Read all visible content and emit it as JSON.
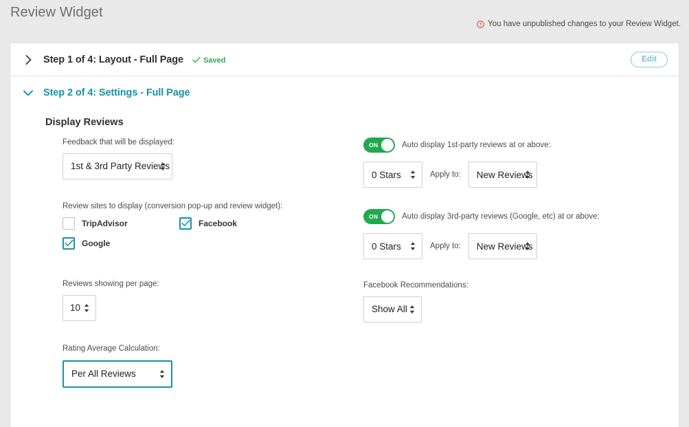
{
  "header": {
    "title": "Review Widget",
    "unpublished_notice": "You have unpublished changes to your Review Widget.",
    "warning_icon": "warning-circle-icon"
  },
  "steps": [
    {
      "chevron": "chevron-right-icon",
      "label": "Step 1 of 4: Layout - Full Page",
      "status": "Saved",
      "status_icon": "check-icon",
      "action_label": "Edit"
    },
    {
      "chevron": "chevron-down-icon",
      "label": "Step 2 of 4: Settings - Full Page"
    }
  ],
  "settings": {
    "section_title": "Display Reviews",
    "left": {
      "feedback": {
        "label": "Feedback that will be displayed:",
        "value": "1st & 3rd Party Reviews"
      },
      "review_sites": {
        "label": "Review sites to display (conversion pop-up and review widget):",
        "items": [
          {
            "name": "TripAdvisor",
            "checked": false
          },
          {
            "name": "Facebook",
            "checked": true
          },
          {
            "name": "Google",
            "checked": true
          }
        ]
      },
      "per_page": {
        "label": "Reviews showing per page:",
        "value": "10"
      },
      "rating_average": {
        "label": "Rating Average Calculation:",
        "value": "Per All Reviews",
        "focused": true
      }
    },
    "right": {
      "first_party": {
        "toggle_state": "ON",
        "label": "Auto display 1st-party reviews at or above:",
        "stars_value": "0 Stars",
        "apply_label": "Apply to:",
        "apply_value": "New Reviews"
      },
      "third_party": {
        "toggle_state": "ON",
        "label": "Auto display 3rd-party reviews (Google, etc) at or above:",
        "stars_value": "0 Stars",
        "apply_label": "Apply to:",
        "apply_value": "New Reviews"
      },
      "facebook_recommendations": {
        "label": "Facebook Recommendations:",
        "value": "Show All"
      }
    }
  },
  "colors": {
    "page_bg": "#e9e9e9",
    "teal": "#1593a6",
    "green": "#22a94e",
    "saved_green": "#2fa84f",
    "warning_red": "#e0342b",
    "edit_blue": "#7fc0cf"
  }
}
